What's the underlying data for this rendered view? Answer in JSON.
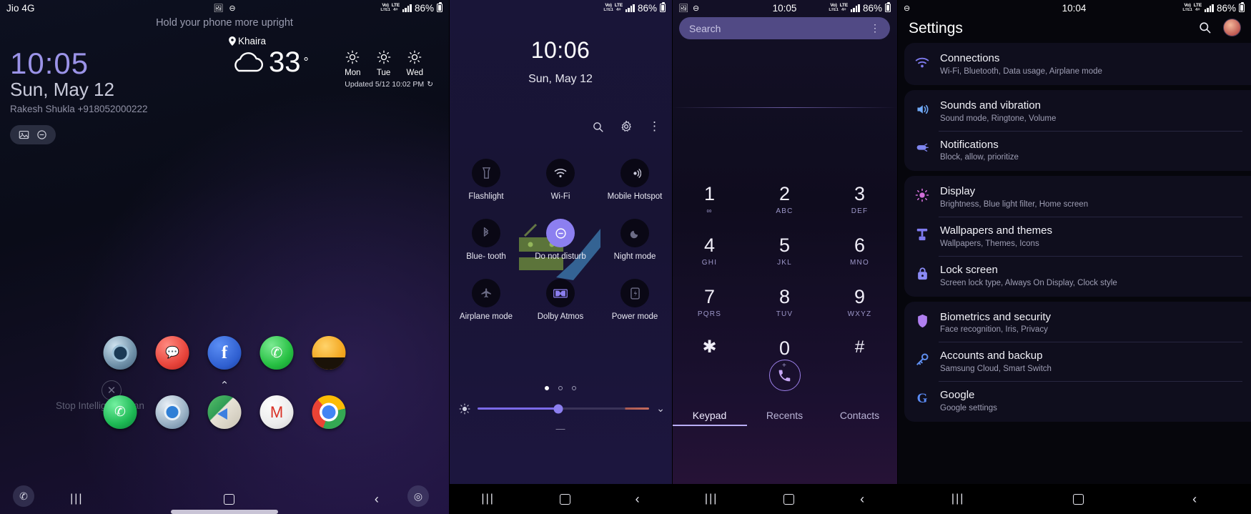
{
  "panels": {
    "lockscreen": {
      "statusbar": {
        "carrier": "Jio 4G",
        "battery": "86%",
        "net_primary": "Vo)",
        "net_label1": "LTE1",
        "net_label2": "LTE",
        "net_label3": "4+"
      },
      "hint": "Hold your phone more upright",
      "time": "10:05",
      "date": "Sun, May 12",
      "owner": "Rakesh Shukla +918052000222",
      "chips": [
        "gallery-icon",
        "do-not-disturb-icon"
      ],
      "weather": {
        "location": "Khaira",
        "temperature": "33",
        "degree": "°",
        "condition_icon": "cloud-icon",
        "forecast": [
          {
            "day": "Mon",
            "icon": "sun-icon"
          },
          {
            "day": "Tue",
            "icon": "sun-icon"
          },
          {
            "day": "Wed",
            "icon": "sun-icon"
          }
        ],
        "updated": "Updated 5/12 10:02 PM"
      },
      "intelligent_scan": "Stop Intelligent Scan",
      "dock_row1": [
        "samsung-internet-icon",
        "messages-icon",
        "facebook-icon",
        "whatsapp-icon",
        "contacts-photo-icon"
      ],
      "dock_row2": [
        "phone-icon",
        "chrome-blue-icon",
        "maps-icon",
        "gmail-icon",
        "chrome-icon"
      ],
      "shortcut_left": "phone-shortcut",
      "shortcut_right": "camera-shortcut"
    },
    "quicksettings": {
      "statusbar": {
        "battery": "86%"
      },
      "time": "10:06",
      "date": "Sun, May 12",
      "actions": [
        "search-icon",
        "gear-icon",
        "kebab-menu-icon"
      ],
      "toggles": [
        {
          "label": "Flashlight",
          "icon": "flashlight-icon",
          "on": false
        },
        {
          "label": "Wi-Fi",
          "icon": "wifi-icon",
          "on": false
        },
        {
          "label": "Mobile\nHotspot",
          "icon": "hotspot-icon",
          "on": false
        },
        {
          "label": "Blue-\ntooth",
          "icon": "bluetooth-icon",
          "on": false
        },
        {
          "label": "Do not\ndisturb",
          "icon": "do-not-disturb-icon",
          "on": true
        },
        {
          "label": "Night\nmode",
          "icon": "moon-icon",
          "on": false
        },
        {
          "label": "Airplane\nmode",
          "icon": "airplane-icon",
          "on": false
        },
        {
          "label": "Dolby\nAtmos",
          "icon": "dolby-icon",
          "on": false
        },
        {
          "label": "Power\nmode",
          "icon": "power-mode-icon",
          "on": false
        }
      ],
      "page_dots": 3,
      "page_active": 1,
      "brightness_percent": 47
    },
    "dialer": {
      "statusbar": {
        "time": "10:05",
        "battery": "86%"
      },
      "search_placeholder": "Search",
      "kebab": "⋮",
      "keys": [
        {
          "num": "1",
          "sub": "∞"
        },
        {
          "num": "2",
          "sub": "ABC"
        },
        {
          "num": "3",
          "sub": "DEF"
        },
        {
          "num": "4",
          "sub": "GHI"
        },
        {
          "num": "5",
          "sub": "JKL"
        },
        {
          "num": "6",
          "sub": "MNO"
        },
        {
          "num": "7",
          "sub": "PQRS"
        },
        {
          "num": "8",
          "sub": "TUV"
        },
        {
          "num": "9",
          "sub": "WXYZ"
        },
        {
          "num": "✱",
          "sub": ""
        },
        {
          "num": "0",
          "sub": "+"
        },
        {
          "num": "#",
          "sub": ""
        }
      ],
      "call_button": "call-icon",
      "tabs": [
        {
          "label": "Keypad",
          "active": true
        },
        {
          "label": "Recents",
          "active": false
        },
        {
          "label": "Contacts",
          "active": false
        }
      ]
    },
    "settings": {
      "statusbar": {
        "time": "10:04",
        "battery": "86%"
      },
      "title": "Settings",
      "search_icon": "search-icon",
      "avatar": "profile-avatar",
      "groups": [
        {
          "items": [
            {
              "title": "Connections",
              "subtitle": "Wi-Fi, Bluetooth, Data usage, Airplane mode",
              "icon": "wifi-icon",
              "color": "#7f7bf0"
            }
          ]
        },
        {
          "items": [
            {
              "title": "Sounds and vibration",
              "subtitle": "Sound mode, Ringtone, Volume",
              "icon": "speaker-icon",
              "color": "#6fa8f5"
            },
            {
              "title": "Notifications",
              "subtitle": "Block, allow, prioritize",
              "icon": "notification-icon",
              "color": "#7f86f0"
            }
          ]
        },
        {
          "items": [
            {
              "title": "Display",
              "subtitle": "Brightness, Blue light filter, Home screen",
              "icon": "brightness-icon",
              "color": "#d26fd9"
            },
            {
              "title": "Wallpapers and themes",
              "subtitle": "Wallpapers, Themes, Icons",
              "icon": "palette-icon",
              "color": "#7f7bf0"
            },
            {
              "title": "Lock screen",
              "subtitle": "Screen lock type, Always On Display, Clock style",
              "icon": "lock-icon",
              "color": "#8a8af5"
            }
          ]
        },
        {
          "items": [
            {
              "title": "Biometrics and security",
              "subtitle": "Face recognition, Iris, Privacy",
              "icon": "shield-icon",
              "color": "#b07ff0"
            },
            {
              "title": "Accounts and backup",
              "subtitle": "Samsung Cloud, Smart Switch",
              "icon": "key-icon",
              "color": "#5f8ff0"
            },
            {
              "title": "Google",
              "subtitle": "Google settings",
              "icon": "google-icon",
              "color": "#5b8cf5"
            }
          ]
        }
      ]
    }
  },
  "navbar": {
    "recents": "|||",
    "home": "home-square",
    "back": "‹"
  },
  "colors": {
    "accent": "#8c7ff0",
    "qs_bg": "#181434",
    "settings_card": "#0f0e1d"
  }
}
